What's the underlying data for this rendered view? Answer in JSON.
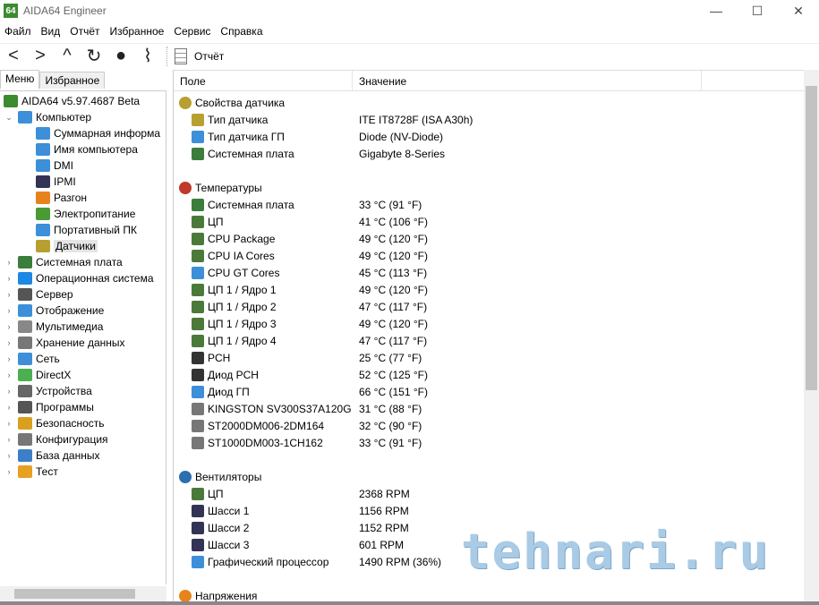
{
  "window": {
    "title": "AIDA64 Engineer",
    "logo": "64",
    "minimize": "—",
    "maximize": "☐",
    "close": "✕"
  },
  "menu": [
    "Файл",
    "Вид",
    "Отчёт",
    "Избранное",
    "Сервис",
    "Справка"
  ],
  "toolbar": {
    "report_label": "Отчёт",
    "icons": [
      "back-icon",
      "forward-icon",
      "up-icon",
      "refresh-icon",
      "user-icon",
      "chart-icon"
    ]
  },
  "tabs": {
    "menu": "Меню",
    "favorites": "Избранное"
  },
  "tree": [
    {
      "label": "AIDA64 v5.97.4687 Beta",
      "level": 0,
      "color": "#3a8c2f",
      "arrow": ""
    },
    {
      "label": "Компьютер",
      "level": 1,
      "color": "#3c8fd8",
      "arrow": "⌄"
    },
    {
      "label": "Суммарная информа",
      "level": 2,
      "color": "#3c8fd8",
      "arrow": ""
    },
    {
      "label": "Имя компьютера",
      "level": 2,
      "color": "#3c8fd8",
      "arrow": ""
    },
    {
      "label": "DMI",
      "level": 2,
      "color": "#3c8fd8",
      "arrow": ""
    },
    {
      "label": "IPMI",
      "level": 2,
      "color": "#335",
      "arrow": ""
    },
    {
      "label": "Разгон",
      "level": 2,
      "color": "#e8831c",
      "arrow": ""
    },
    {
      "label": "Электропитание",
      "level": 2,
      "color": "#4a9a35",
      "arrow": ""
    },
    {
      "label": "Портативный ПК",
      "level": 2,
      "color": "#3c8fd8",
      "arrow": ""
    },
    {
      "label": "Датчики",
      "level": 2,
      "color": "#b8a030",
      "arrow": "",
      "selected": true
    },
    {
      "label": "Системная плата",
      "level": 1,
      "color": "#3b7d3b",
      "arrow": "›"
    },
    {
      "label": "Операционная система",
      "level": 1,
      "color": "#1e88e5",
      "arrow": "›"
    },
    {
      "label": "Сервер",
      "level": 1,
      "color": "#555",
      "arrow": "›"
    },
    {
      "label": "Отображение",
      "level": 1,
      "color": "#3c8fd8",
      "arrow": "›"
    },
    {
      "label": "Мультимедиа",
      "level": 1,
      "color": "#888",
      "arrow": "›"
    },
    {
      "label": "Хранение данных",
      "level": 1,
      "color": "#777",
      "arrow": "›"
    },
    {
      "label": "Сеть",
      "level": 1,
      "color": "#3c8fd8",
      "arrow": "›"
    },
    {
      "label": "DirectX",
      "level": 1,
      "color": "#4caf50",
      "arrow": "›"
    },
    {
      "label": "Устройства",
      "level": 1,
      "color": "#666",
      "arrow": "›"
    },
    {
      "label": "Программы",
      "level": 1,
      "color": "#555",
      "arrow": "›"
    },
    {
      "label": "Безопасность",
      "level": 1,
      "color": "#d9a020",
      "arrow": "›"
    },
    {
      "label": "Конфигурация",
      "level": 1,
      "color": "#777",
      "arrow": "›"
    },
    {
      "label": "База данных",
      "level": 1,
      "color": "#3c7fc8",
      "arrow": "›"
    },
    {
      "label": "Тест",
      "level": 1,
      "color": "#e8a020",
      "arrow": "›"
    }
  ],
  "columns": {
    "field": "Поле",
    "value": "Значение"
  },
  "sections": [
    {
      "title": "Свойства датчика",
      "color": "#b8a030",
      "rows": [
        {
          "field": "Тип датчика",
          "value": "ITE IT8728F  (ISA A30h)",
          "color": "#b8a030"
        },
        {
          "field": "Тип датчика ГП",
          "value": "Diode  (NV-Diode)",
          "color": "#3c8fd8"
        },
        {
          "field": "Системная плата",
          "value": "Gigabyte 8-Series",
          "color": "#3b7d3b"
        }
      ]
    },
    {
      "title": "Температуры",
      "color": "#c0392b",
      "rows": [
        {
          "field": "Системная плата",
          "value": "33 °C  (91 °F)",
          "color": "#3b7d3b"
        },
        {
          "field": "ЦП",
          "value": "41 °C  (106 °F)",
          "color": "#4a7a3a"
        },
        {
          "field": "CPU Package",
          "value": "49 °C  (120 °F)",
          "color": "#4a7a3a"
        },
        {
          "field": "CPU IA Cores",
          "value": "49 °C  (120 °F)",
          "color": "#4a7a3a"
        },
        {
          "field": "CPU GT Cores",
          "value": "45 °C  (113 °F)",
          "color": "#3c8fd8"
        },
        {
          "field": "ЦП 1 / Ядро 1",
          "value": "49 °C  (120 °F)",
          "color": "#4a7a3a"
        },
        {
          "field": "ЦП 1 / Ядро 2",
          "value": "47 °C  (117 °F)",
          "color": "#4a7a3a"
        },
        {
          "field": "ЦП 1 / Ядро 3",
          "value": "49 °C  (120 °F)",
          "color": "#4a7a3a"
        },
        {
          "field": "ЦП 1 / Ядро 4",
          "value": "47 °C  (117 °F)",
          "color": "#4a7a3a"
        },
        {
          "field": "PCH",
          "value": "25 °C  (77 °F)",
          "color": "#333"
        },
        {
          "field": "Диод PCH",
          "value": "52 °C  (125 °F)",
          "color": "#333"
        },
        {
          "field": "Диод ГП",
          "value": "66 °C  (151 °F)",
          "color": "#3c8fd8"
        },
        {
          "field": "KINGSTON SV300S37A120G",
          "value": "31 °C  (88 °F)",
          "color": "#777"
        },
        {
          "field": "ST2000DM006-2DM164",
          "value": "32 °C  (90 °F)",
          "color": "#777"
        },
        {
          "field": "ST1000DM003-1CH162",
          "value": "33 °C  (91 °F)",
          "color": "#777"
        }
      ]
    },
    {
      "title": "Вентиляторы",
      "color": "#2a6fb0",
      "rows": [
        {
          "field": "ЦП",
          "value": "2368 RPM",
          "color": "#4a7a3a"
        },
        {
          "field": "Шасси 1",
          "value": "1156 RPM",
          "color": "#335"
        },
        {
          "field": "Шасси 2",
          "value": "1152 RPM",
          "color": "#335"
        },
        {
          "field": "Шасси 3",
          "value": "601 RPM",
          "color": "#335"
        },
        {
          "field": "Графический процессор",
          "value": "1490 RPM  (36%)",
          "color": "#3c8fd8"
        }
      ]
    },
    {
      "title": "Напряжения",
      "color": "#e8831c",
      "rows": []
    }
  ],
  "watermark": "tehnari.ru"
}
